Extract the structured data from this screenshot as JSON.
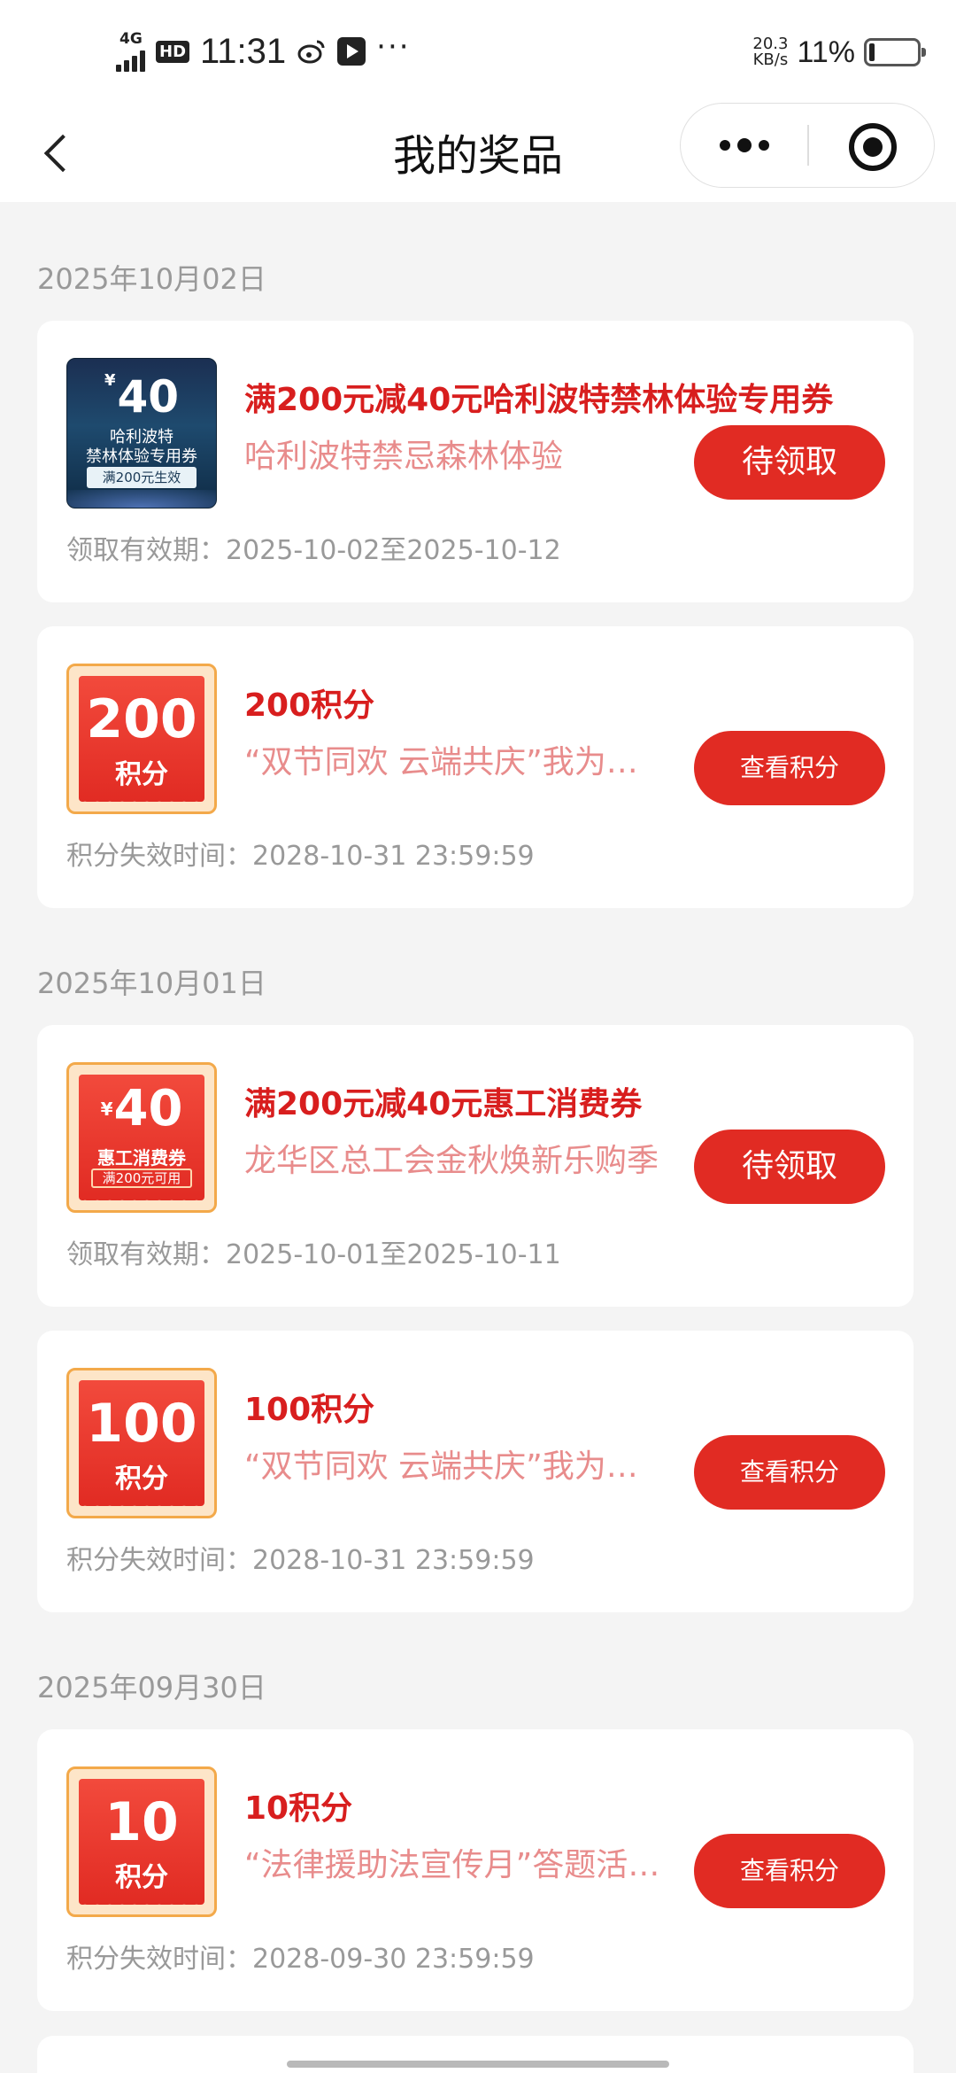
{
  "status_bar": {
    "network": "4G",
    "hd": "HD",
    "time": "11:31",
    "more": "···",
    "net_speed_value": "20.3",
    "net_speed_unit": "KB/s",
    "battery_pct": "11%"
  },
  "nav": {
    "title": "我的奖品"
  },
  "groups": [
    {
      "date": "2025年10月02日",
      "items": [
        {
          "thumb_amount": "40",
          "thumb_currency": "¥",
          "thumb_line1": "哈利波特",
          "thumb_line2": "禁林体验专用券",
          "thumb_condition": "满200元生效",
          "title": "满200元减40元哈利波特禁林体验专用券",
          "desc": "哈利波特禁忌森林体验",
          "button": "待领取",
          "meta": "领取有效期：2025-10-02至2025-10-12"
        },
        {
          "thumb_amount": "200",
          "thumb_sub": "积分",
          "title": "200积分",
          "desc": "“双节同欢 云端共庆”我为深圳工会开启十月的第一个工会知识答题活动",
          "button": "查看积分",
          "meta": "积分失效时间：2028-10-31 23:59:59"
        }
      ]
    },
    {
      "date": "2025年10月01日",
      "items": [
        {
          "thumb_amount": "40",
          "thumb_currency": "¥",
          "thumb_sub": "惠工消费券",
          "thumb_condition": "满200元可用",
          "title": "满200元减40元惠工消费券",
          "desc": "龙华区总工会金秋焕新乐购季",
          "button": "待领取",
          "meta": "领取有效期：2025-10-01至2025-10-11"
        },
        {
          "thumb_amount": "100",
          "thumb_sub": "积分",
          "title": "100积分",
          "desc": "“双节同欢 云端共庆”我为深圳工会开启十月的第一个工会知识答题活动",
          "button": "查看积分",
          "meta": "积分失效时间：2028-10-31 23:59:59"
        }
      ]
    },
    {
      "date": "2025年09月30日",
      "items": [
        {
          "thumb_amount": "10",
          "thumb_sub": "积分",
          "title": "10积分",
          "desc": "“法律援助法宣传月”答题活动知识竞赛",
          "button": "查看积分",
          "meta": "积分失效时间：2028-09-30 23:59:59"
        }
      ]
    }
  ]
}
